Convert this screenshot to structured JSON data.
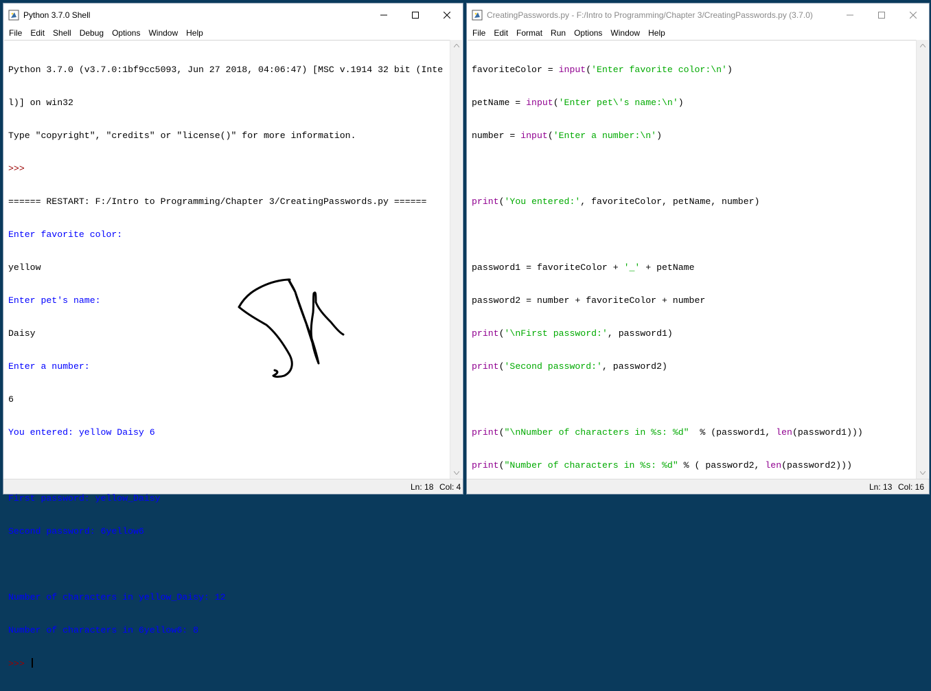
{
  "shell": {
    "title": "Python 3.7.0 Shell",
    "menu": [
      "File",
      "Edit",
      "Shell",
      "Debug",
      "Options",
      "Window",
      "Help"
    ],
    "lines": [
      "Python 3.7.0 (v3.7.0:1bf9cc5093, Jun 27 2018, 04:06:47) [MSC v.1914 32 bit (Inte",
      "l)] on win32",
      "Type \"copyright\", \"credits\" or \"license()\" for more information.",
      ">>> ",
      "====== RESTART: F:/Intro to Programming/Chapter 3/CreatingPasswords.py ======",
      "Enter favorite color:",
      "yellow",
      "Enter pet's name:",
      "Daisy",
      "Enter a number:",
      "6",
      "You entered: yellow Daisy 6",
      "",
      "First password: yellow_Daisy",
      "Second password: 6yellow6",
      "",
      "Number of characters in yellow_Daisy: 12",
      "Number of characters in 6yellow6: 8",
      ">>> "
    ],
    "status": {
      "ln": "Ln: 18",
      "col": "Col: 4"
    }
  },
  "editor": {
    "title": "CreatingPasswords.py - F:/Intro to Programming/Chapter 3/CreatingPasswords.py (3.7.0)",
    "menu": [
      "File",
      "Edit",
      "Format",
      "Run",
      "Options",
      "Window",
      "Help"
    ],
    "lines": [
      "favoriteColor = input('Enter favorite color:\\n')",
      "petName = input('Enter pet\\'s name:\\n')",
      "number = input('Enter a number:\\n')",
      "",
      "print('You entered:', favoriteColor, petName, number)",
      "",
      "password1 = favoriteColor + '_' + petName",
      "password2 = number + favoriteColor + number",
      "print('\\nFirst password:', password1)",
      "print('Second password:', password2)",
      "",
      "print(\"\\nNumber of characters in %s: %d\"  % (password1, len(password1)))",
      "print(\"Number of characters in %s: %d\" % ( password2, len(password2)))"
    ],
    "status": {
      "ln": "Ln: 13",
      "col": "Col: 16"
    }
  },
  "colors": {
    "desktop": "#0a3a5c",
    "shell_output": "#0000ff",
    "prompt": "#990000",
    "builtin": "#900090",
    "string": "#00aa00"
  }
}
